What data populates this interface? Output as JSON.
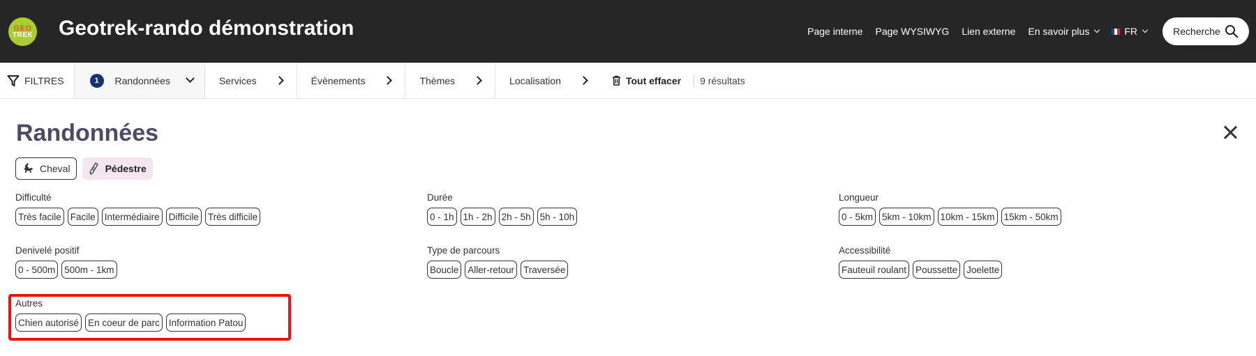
{
  "header": {
    "logo_top": "GEO",
    "logo_bottom": "TREK",
    "title": "Geotrek-rando démonstration",
    "nav": [
      "Page interne",
      "Page WYSIWYG",
      "Lien externe"
    ],
    "more_label": "En savoir plus",
    "language": "FR",
    "search_label": "Recherche"
  },
  "filter_bar": {
    "filters_label": "FILTRES",
    "active_count": "1",
    "tabs": [
      "Randonnées",
      "Services",
      "Évènements",
      "Thèmes",
      "Localisation"
    ],
    "clear_label": "Tout effacer",
    "results": "9 résultats"
  },
  "panel": {
    "title": "Randonnées",
    "practices": [
      {
        "label": "Cheval",
        "icon": "horse-rider-icon",
        "active": false
      },
      {
        "label": "Pédestre",
        "icon": "hiking-boot-icon",
        "active": true
      }
    ],
    "groups": {
      "difficulte": {
        "label": "Difficulté",
        "options": [
          "Très facile",
          "Facile",
          "Intermédiaire",
          "Difficile",
          "Très difficile"
        ]
      },
      "duree": {
        "label": "Durée",
        "options": [
          "0 - 1h",
          "1h - 2h",
          "2h - 5h",
          "5h - 10h"
        ]
      },
      "longueur": {
        "label": "Longueur",
        "options": [
          "0 - 5km",
          "5km - 10km",
          "10km - 15km",
          "15km - 50km"
        ]
      },
      "denivele": {
        "label": "Denivelé positif",
        "options": [
          "0 - 500m",
          "500m - 1km"
        ]
      },
      "parcours": {
        "label": "Type de parcours",
        "options": [
          "Boucle",
          "Aller-retour",
          "Traversée"
        ]
      },
      "accessibilite": {
        "label": "Accessibilité",
        "options": [
          "Fauteuil roulant",
          "Poussette",
          "Joelette"
        ]
      },
      "autres": {
        "label": "Autres",
        "options": [
          "Chien autorisé",
          "En coeur de parc",
          "Information Patou"
        ]
      }
    }
  },
  "colors": {
    "header_bg": "#262626",
    "logo_green": "#aacd2f",
    "badge_blue": "#14317a",
    "title_color": "#4e4a63",
    "active_practice_bg": "#f3e6ee",
    "highlight_red": "#ee1111"
  }
}
